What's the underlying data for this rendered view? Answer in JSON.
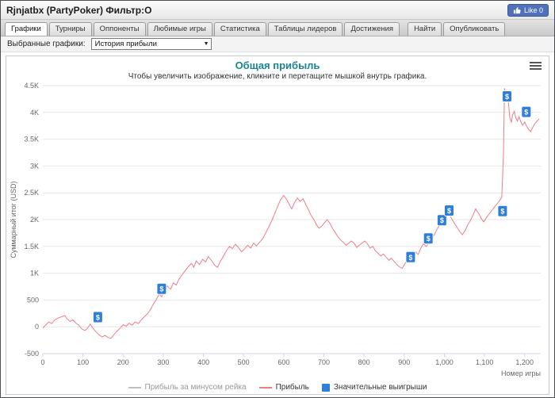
{
  "header": {
    "title": "Rjnjatbx (PartyPoker) Фильтр:О",
    "like_label": "Like 0"
  },
  "tabs": [
    {
      "id": "graphs",
      "label": "Графики",
      "active": true
    },
    {
      "id": "tournaments",
      "label": "Турниры",
      "active": false
    },
    {
      "id": "opponents",
      "label": "Оппоненты",
      "active": false
    },
    {
      "id": "favorite-games",
      "label": "Любимые игры",
      "active": false
    },
    {
      "id": "statistics",
      "label": "Статистика",
      "active": false
    },
    {
      "id": "leaderboards",
      "label": "Таблицы лидеров",
      "active": false
    },
    {
      "id": "achievements",
      "label": "Достижения",
      "active": false
    },
    {
      "id": "find",
      "label": "Найти",
      "active": false,
      "gap_before": true
    },
    {
      "id": "publish",
      "label": "Опубликовать",
      "active": false
    }
  ],
  "filter": {
    "label": "Выбранные графики:",
    "selected": "История прибыли"
  },
  "chart_data": {
    "type": "line",
    "title": "Общая прибыль",
    "subtitle": "Чтобы увеличить изображение, кликните и перетащите мышкой внутрь графика.",
    "xlabel": "Номер игры",
    "ylabel": "Суммарный итог (USD)",
    "xlim": [
      0,
      1240
    ],
    "ylim": [
      -500,
      4500
    ],
    "xticks": [
      0,
      100,
      200,
      300,
      400,
      500,
      600,
      700,
      800,
      900,
      1000,
      1100,
      1200
    ],
    "xtick_labels": [
      "0",
      "100",
      "200",
      "300",
      "400",
      "500",
      "600",
      "700",
      "800",
      "900",
      "1,000",
      "1,100",
      "1,200"
    ],
    "yticks": [
      -500,
      0,
      500,
      1000,
      1500,
      2000,
      2500,
      3000,
      3500,
      4000,
      4500
    ],
    "ytick_labels": [
      "-500",
      "0",
      "500",
      "1K",
      "1.5K",
      "2K",
      "2.5K",
      "3K",
      "3.5K",
      "4K",
      "4.5K"
    ],
    "grid": true,
    "legend_position": "bottom",
    "series": [
      {
        "name": "Прибыль",
        "color": "#ed7d8b",
        "points": [
          [
            0,
            -20
          ],
          [
            8,
            40
          ],
          [
            15,
            90
          ],
          [
            22,
            60
          ],
          [
            30,
            130
          ],
          [
            40,
            170
          ],
          [
            50,
            195
          ],
          [
            55,
            210
          ],
          [
            60,
            150
          ],
          [
            68,
            100
          ],
          [
            75,
            130
          ],
          [
            82,
            70
          ],
          [
            90,
            30
          ],
          [
            97,
            -40
          ],
          [
            105,
            -70
          ],
          [
            112,
            -20
          ],
          [
            118,
            50
          ],
          [
            125,
            -30
          ],
          [
            132,
            -90
          ],
          [
            140,
            -150
          ],
          [
            148,
            -190
          ],
          [
            155,
            -160
          ],
          [
            162,
            -200
          ],
          [
            170,
            -215
          ],
          [
            178,
            -140
          ],
          [
            185,
            -80
          ],
          [
            192,
            -30
          ],
          [
            200,
            40
          ],
          [
            208,
            10
          ],
          [
            215,
            70
          ],
          [
            222,
            30
          ],
          [
            230,
            90
          ],
          [
            238,
            60
          ],
          [
            245,
            130
          ],
          [
            252,
            180
          ],
          [
            260,
            240
          ],
          [
            268,
            320
          ],
          [
            275,
            420
          ],
          [
            282,
            500
          ],
          [
            290,
            610
          ],
          [
            296,
            560
          ],
          [
            302,
            680
          ],
          [
            310,
            760
          ],
          [
            318,
            700
          ],
          [
            325,
            820
          ],
          [
            332,
            780
          ],
          [
            340,
            900
          ],
          [
            348,
            980
          ],
          [
            355,
            1050
          ],
          [
            362,
            1120
          ],
          [
            370,
            1180
          ],
          [
            376,
            1110
          ],
          [
            382,
            1230
          ],
          [
            390,
            1160
          ],
          [
            398,
            1260
          ],
          [
            405,
            1210
          ],
          [
            412,
            1310
          ],
          [
            420,
            1240
          ],
          [
            428,
            1150
          ],
          [
            435,
            1110
          ],
          [
            442,
            1220
          ],
          [
            450,
            1320
          ],
          [
            458,
            1430
          ],
          [
            465,
            1500
          ],
          [
            472,
            1460
          ],
          [
            480,
            1540
          ],
          [
            488,
            1470
          ],
          [
            495,
            1400
          ],
          [
            502,
            1450
          ],
          [
            510,
            1520
          ],
          [
            518,
            1470
          ],
          [
            525,
            1560
          ],
          [
            532,
            1510
          ],
          [
            540,
            1580
          ],
          [
            548,
            1650
          ],
          [
            555,
            1750
          ],
          [
            562,
            1850
          ],
          [
            570,
            1980
          ],
          [
            578,
            2120
          ],
          [
            585,
            2250
          ],
          [
            592,
            2370
          ],
          [
            600,
            2450
          ],
          [
            607,
            2380
          ],
          [
            614,
            2280
          ],
          [
            620,
            2200
          ],
          [
            627,
            2320
          ],
          [
            634,
            2400
          ],
          [
            641,
            2340
          ],
          [
            648,
            2390
          ],
          [
            655,
            2280
          ],
          [
            662,
            2180
          ],
          [
            668,
            2080
          ],
          [
            675,
            2000
          ],
          [
            682,
            1900
          ],
          [
            688,
            1840
          ],
          [
            695,
            1880
          ],
          [
            702,
            1950
          ],
          [
            708,
            2000
          ],
          [
            715,
            1930
          ],
          [
            722,
            1830
          ],
          [
            728,
            1760
          ],
          [
            735,
            1680
          ],
          [
            742,
            1620
          ],
          [
            748,
            1580
          ],
          [
            755,
            1520
          ],
          [
            762,
            1560
          ],
          [
            768,
            1600
          ],
          [
            775,
            1560
          ],
          [
            782,
            1480
          ],
          [
            788,
            1520
          ],
          [
            795,
            1560
          ],
          [
            802,
            1600
          ],
          [
            808,
            1550
          ],
          [
            815,
            1470
          ],
          [
            822,
            1500
          ],
          [
            828,
            1420
          ],
          [
            835,
            1370
          ],
          [
            842,
            1320
          ],
          [
            848,
            1360
          ],
          [
            855,
            1300
          ],
          [
            862,
            1240
          ],
          [
            868,
            1280
          ],
          [
            875,
            1220
          ],
          [
            882,
            1160
          ],
          [
            888,
            1120
          ],
          [
            895,
            1090
          ],
          [
            902,
            1180
          ],
          [
            908,
            1260
          ],
          [
            915,
            1240
          ],
          [
            922,
            1330
          ],
          [
            928,
            1400
          ],
          [
            935,
            1350
          ],
          [
            942,
            1480
          ],
          [
            948,
            1550
          ],
          [
            955,
            1500
          ],
          [
            962,
            1560
          ],
          [
            968,
            1640
          ],
          [
            975,
            1720
          ],
          [
            982,
            1820
          ],
          [
            988,
            1900
          ],
          [
            995,
            1920
          ],
          [
            1000,
            2000
          ],
          [
            1006,
            2060
          ],
          [
            1012,
            2100
          ],
          [
            1018,
            2020
          ],
          [
            1025,
            1930
          ],
          [
            1032,
            1850
          ],
          [
            1038,
            1780
          ],
          [
            1045,
            1720
          ],
          [
            1052,
            1800
          ],
          [
            1058,
            1900
          ],
          [
            1065,
            1990
          ],
          [
            1072,
            2090
          ],
          [
            1078,
            2200
          ],
          [
            1085,
            2120
          ],
          [
            1092,
            2020
          ],
          [
            1098,
            1960
          ],
          [
            1105,
            2040
          ],
          [
            1112,
            2110
          ],
          [
            1118,
            2170
          ],
          [
            1125,
            2240
          ],
          [
            1132,
            2300
          ],
          [
            1138,
            2360
          ],
          [
            1143,
            2420
          ],
          [
            1147,
            3200
          ],
          [
            1150,
            4450
          ],
          [
            1153,
            4250
          ],
          [
            1157,
            4380
          ],
          [
            1160,
            4150
          ],
          [
            1163,
            3900
          ],
          [
            1167,
            3820
          ],
          [
            1170,
            3950
          ],
          [
            1174,
            4020
          ],
          [
            1178,
            3900
          ],
          [
            1182,
            3840
          ],
          [
            1186,
            3920
          ],
          [
            1190,
            3830
          ],
          [
            1195,
            3760
          ],
          [
            1200,
            3820
          ],
          [
            1205,
            3740
          ],
          [
            1210,
            3680
          ],
          [
            1215,
            3640
          ],
          [
            1220,
            3720
          ],
          [
            1225,
            3790
          ],
          [
            1230,
            3830
          ],
          [
            1236,
            3880
          ]
        ]
      }
    ],
    "markers": {
      "name": "Значительные выигрыши",
      "color": "#2f7ed8",
      "symbol": "$",
      "points": [
        [
          137,
          180
        ],
        [
          296,
          710
        ],
        [
          916,
          1300
        ],
        [
          960,
          1650
        ],
        [
          994,
          1990
        ],
        [
          1012,
          2170
        ],
        [
          1145,
          2160
        ],
        [
          1156,
          4300
        ],
        [
          1204,
          4010
        ]
      ]
    },
    "legend": [
      {
        "label": "Прибыль за минусом рейка",
        "swatch": "line",
        "color": "#bfbfbf",
        "muted": true
      },
      {
        "label": "Прибыль",
        "swatch": "line",
        "color": "#ed7d8b",
        "muted": false
      },
      {
        "label": "Значительные выигрыши",
        "swatch": "square",
        "color": "#2f7ed8",
        "muted": false
      }
    ]
  }
}
